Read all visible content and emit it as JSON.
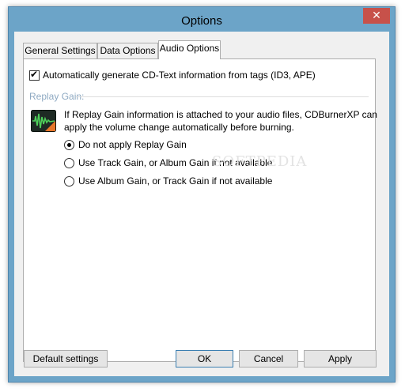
{
  "window": {
    "title": "Options",
    "close_glyph": "✕"
  },
  "tabs": [
    {
      "label": "General Settings",
      "active": false
    },
    {
      "label": "Data Options",
      "active": false
    },
    {
      "label": "Audio Options",
      "active": true
    }
  ],
  "audio": {
    "cdtext_checkbox_label": "Automatically generate CD-Text information from tags (ID3, APE)",
    "cdtext_checked": true,
    "replay_gain_group": "Replay Gain:",
    "replay_gain_description_line1": "If Replay Gain information is attached to your audio files, CDBurnerXP can",
    "replay_gain_description_line2": "apply the volume change automatically before burning.",
    "options": [
      {
        "label": "Do not apply Replay Gain",
        "selected": true
      },
      {
        "label": "Use Track Gain, or Album Gain if not available",
        "selected": false
      },
      {
        "label": "Use Album Gain, or Track Gain if not available",
        "selected": false
      }
    ],
    "icon": "replay-gain-waveform-icon"
  },
  "watermark": "SOFTPEDIA",
  "buttons": {
    "default_settings": "Default settings",
    "ok": "OK",
    "cancel": "Cancel",
    "apply": "Apply"
  },
  "colors": {
    "title_bar": "#6ca4c8",
    "close_button": "#c7514a",
    "group_label": "#8ea9c2",
    "default_button_border": "#3c7fb1"
  }
}
